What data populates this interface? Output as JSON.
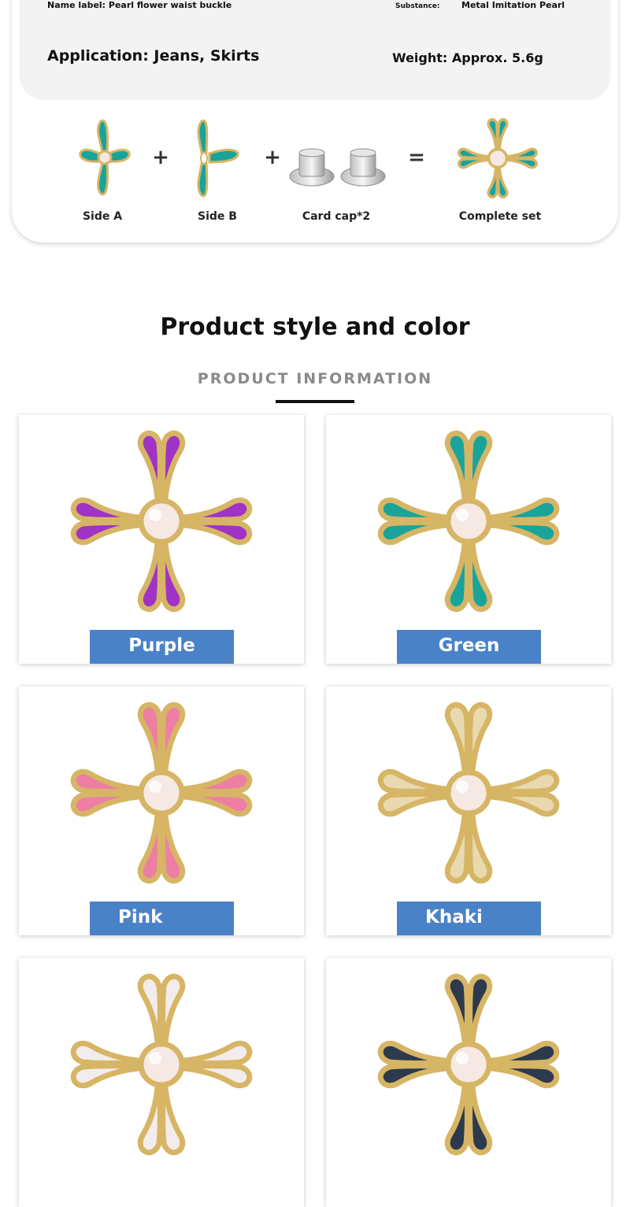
{
  "specs": {
    "name_label": "Name label: Pearl flower waist buckle",
    "substance_label": "Substance:",
    "substance_value": "Metal Imitation Pearl",
    "application": "Application: Jeans, Skirts",
    "weight": "Weight: Approx. 5.6g"
  },
  "assembly": {
    "side_a": "Side A",
    "side_b": "Side B",
    "card_cap": "Card cap*2",
    "complete_set": "Complete set",
    "plus_1": "+",
    "plus_2": "+",
    "equals": "="
  },
  "section": {
    "title": "Product style and color",
    "subtitle": "PRODUCT INFORMATION"
  },
  "colors": {
    "purple": "Purple",
    "green": "Green",
    "pink": "Pink",
    "khaki": "Khaki"
  },
  "palette": {
    "purple": "#a033c6",
    "green": "#1aa39a",
    "pink": "#ee7ea4",
    "khaki": "#e8d9b0",
    "white": "#f3ecec",
    "navy": "#2c3a4d",
    "gold": "#d6b565",
    "tag": "#4a82c8"
  }
}
